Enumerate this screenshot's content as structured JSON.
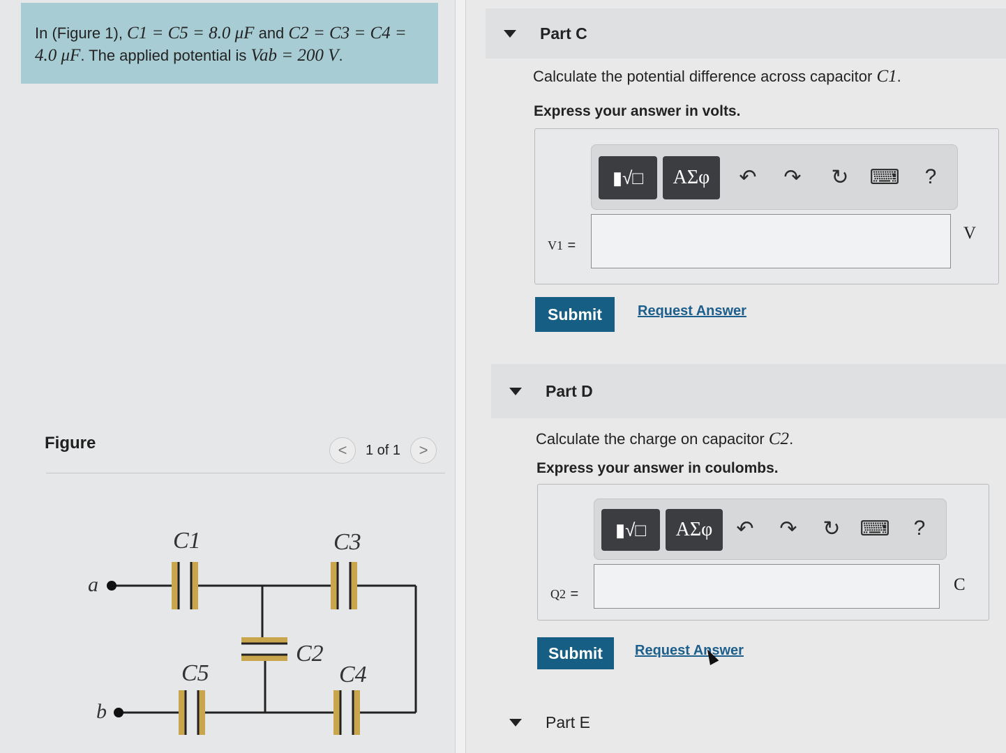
{
  "problem": {
    "prefix": "In (Figure 1), ",
    "eq1": "C1 = C5 = 8.0 μF",
    "mid": " and ",
    "eq2": "C2 = C3 = C4 =",
    "eq3": "4.0 μF",
    "mid2": ". The applied potential is ",
    "eq4": "Vab = 200 V",
    "suffix": "."
  },
  "figure": {
    "title": "Figure",
    "page": "1 of 1",
    "prev": "<",
    "next": ">",
    "labels": {
      "a": "a",
      "b": "b",
      "c1": "C1",
      "c2": "C2",
      "c3": "C3",
      "c4": "C4",
      "c5": "C5"
    }
  },
  "partC": {
    "title": "Part C",
    "question": "Calculate the potential difference across capacitor ",
    "question_var": "C1",
    "question_end": ".",
    "instruction": "Express your answer in volts.",
    "var": "V1",
    "eq": "=",
    "unit": "V",
    "submit": "Submit",
    "request": "Request Answer"
  },
  "partD": {
    "title": "Part D",
    "question": "Calculate the charge on capacitor ",
    "question_var": "C2",
    "question_end": ".",
    "instruction": "Express your answer in coulombs.",
    "var": "Q2",
    "eq": "=",
    "unit": "C",
    "submit": "Submit",
    "request": "Request Answer"
  },
  "partE": {
    "title": "Part E"
  },
  "toolbar": {
    "templates": "▮√□",
    "greek": "ΑΣφ",
    "undo": "↶",
    "redo": "↷",
    "reset": "↻",
    "keyboard": "⌨",
    "help": "?"
  },
  "colors": {
    "problem_bg": "#a7ccd3",
    "submit_bg": "#165e83",
    "link": "#1d5f8c",
    "capacitor": "#c9a64e"
  }
}
